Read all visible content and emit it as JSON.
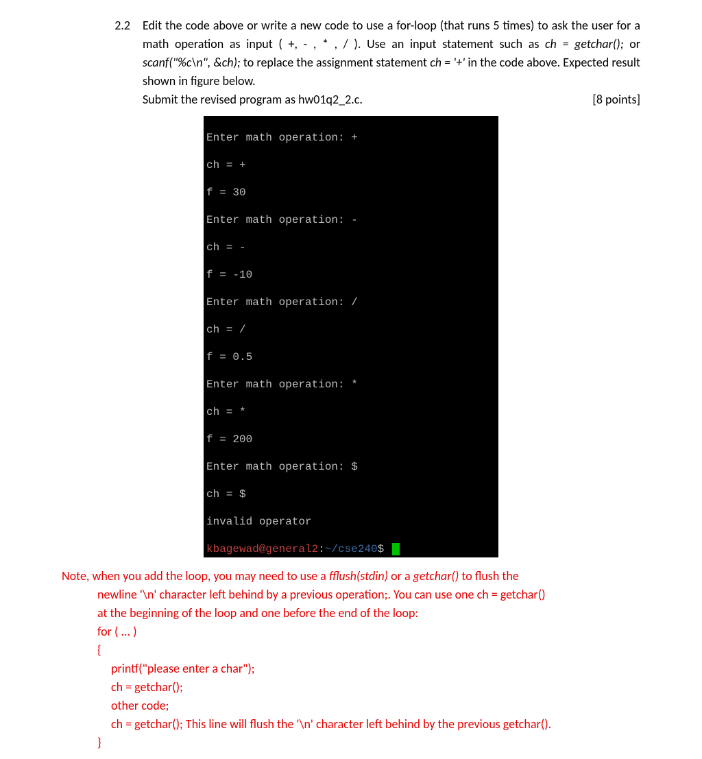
{
  "question": {
    "number": "2.2",
    "text_part1": "Edit the code above or write a new code to use a for-loop (that runs 5 times) to ask the user for a math operation as input ( +, - , * , / ). Use an input statement such as ",
    "code1": "ch = getchar();",
    "text_part2": " or ",
    "code2": "scanf(\"%c\\n\", &ch);",
    "text_part3": " to replace the assignment statement ",
    "code3": "ch = '+'",
    "text_part4": " in the code above. Expected result shown in figure below. ",
    "submit_text": "Submit the revised program as ",
    "filename": "hw01q2_2.c.",
    "points": "[8 points]"
  },
  "terminal": {
    "lines": [
      "Enter math operation: +",
      "ch = +",
      "f = 30",
      "Enter math operation: -",
      "ch = -",
      "f = -10",
      "Enter math operation: /",
      "ch = /",
      "f = 0.5",
      "Enter math operation: *",
      "ch = *",
      "f = 200",
      "Enter math operation: $",
      "ch = $",
      "invalid operator"
    ],
    "prompt_user": "kbagewad@general2",
    "prompt_colon": ":",
    "prompt_path": "~/cse240",
    "prompt_dollar": "$"
  },
  "note": {
    "line1a": "Note, when you add the loop, you may need to use a ",
    "line1b": "fflush(stdin)",
    "line1c": " or a ",
    "line1d": "getchar()",
    "line1e": " to flush the",
    "line2": "newline '\\n' character left behind by a previous operation;. You can use one ch = getchar()",
    "line3": "at the beginning of the loop and one before the end of the loop:",
    "line4": "for ( ... )",
    "line5": "{",
    "line6": "printf(\"please enter a char\");",
    "line7": "ch = getchar();",
    "line8": "other code;",
    "line9": "ch = getchar(); This line will flush the '\\n' character left behind by the previous getchar().",
    "line10": "}"
  }
}
